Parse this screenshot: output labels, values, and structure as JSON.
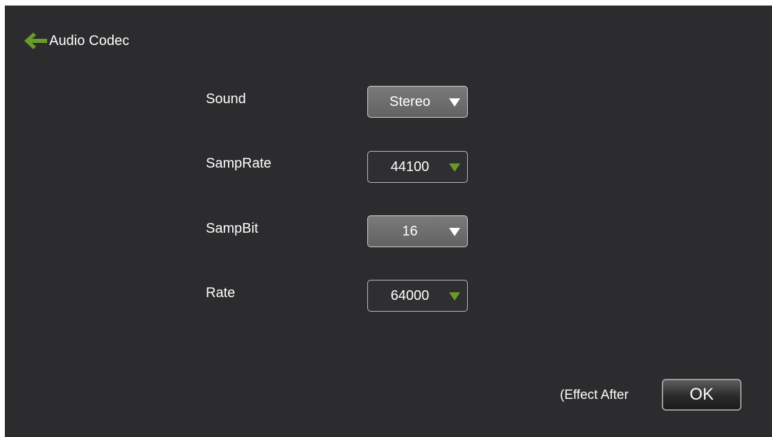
{
  "header": {
    "title": "Audio Codec",
    "back_icon": "arrow-left-icon",
    "accent_color": "#6a9a2a"
  },
  "settings": [
    {
      "label": "Sound",
      "value": "Stereo",
      "state": "focused"
    },
    {
      "label": "SampRate",
      "value": "44100",
      "state": "enabled"
    },
    {
      "label": "SampBit",
      "value": "16",
      "state": "focused"
    },
    {
      "label": "Rate",
      "value": "64000",
      "state": "enabled"
    }
  ],
  "footer": {
    "effect_text": "(Effect After",
    "ok_label": "OK"
  }
}
